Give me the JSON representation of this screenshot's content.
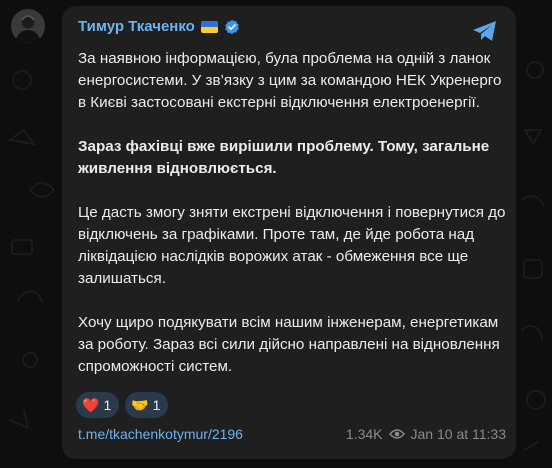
{
  "post": {
    "author": "Тимур Ткаченко",
    "paragraphs": [
      {
        "text": "За наявною інформацією, була проблема на одній з ланок енергосистеми. У зв’язку з цим за командою НЕК Укренерго в Києві застосовані екстерні відключення електроенергії.",
        "bold": false
      },
      {
        "text": "Зараз фахівці вже вирішили проблему. Тому, загальне живлення відновлюється.",
        "bold": true
      },
      {
        "text": "Це дасть змогу зняти екстрені відключення і повернутися до відключень за графіками. Проте там, де йде робота над ліквідацією наслідків ворожих атак - обмеження все ще залишаться.",
        "bold": false
      },
      {
        "text": "Хочу щиро подякувати всім нашим інженерам, енергетикам за роботу. Зараз всі сили дійсно направлені на відновлення спроможності систем.",
        "bold": false
      }
    ],
    "reactions": [
      {
        "emoji": "❤️",
        "count": "1"
      },
      {
        "emoji": "🤝",
        "count": "1"
      }
    ],
    "link": "t.me/tkachenkotymur/2196",
    "views": "1.34K",
    "date": "Jan 10 at 11:33"
  },
  "icons": {
    "avatar": "avatar",
    "flag": "ukraine-flag-icon",
    "verified": "verified-badge-icon",
    "share": "telegram-share-icon",
    "views": "eye-icon"
  },
  "colors": {
    "background": "#0e0e0e",
    "card": "#1f1f1f",
    "author": "#6cb3f2",
    "link": "#6cb3f2",
    "reaction_bg": "#2b3a4a"
  }
}
